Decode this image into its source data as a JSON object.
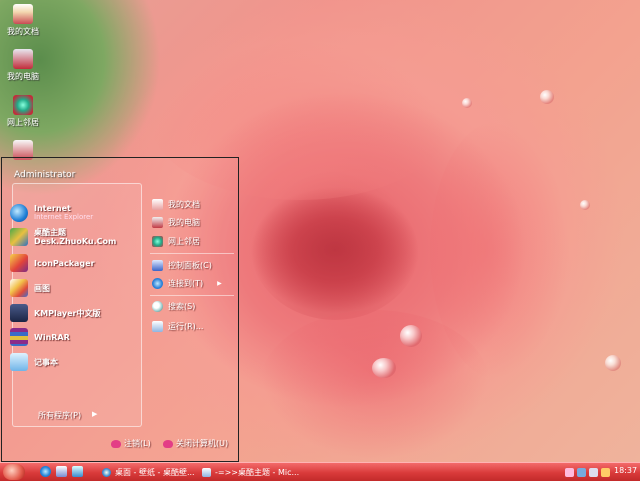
{
  "desktop": {
    "icons": [
      {
        "label": "我的文档"
      },
      {
        "label": "我的电脑"
      },
      {
        "label": "网上邻居"
      }
    ]
  },
  "start_menu": {
    "user_name": "Administrator",
    "pinned": [
      {
        "title": "Internet",
        "subtitle": "Internet Explorer"
      },
      {
        "title": "桌酷主题",
        "subtitle": "Desk.ZhuoKu.Com"
      },
      {
        "title": "IconPackager",
        "subtitle": ""
      },
      {
        "title": "画图",
        "subtitle": ""
      },
      {
        "title": "KMPlayer中文版",
        "subtitle": ""
      },
      {
        "title": "WinRAR",
        "subtitle": ""
      },
      {
        "title": "记事本",
        "subtitle": ""
      }
    ],
    "all_programs": "所有程序(P)",
    "places": [
      {
        "label": "我的文档"
      },
      {
        "label": "我的电脑"
      },
      {
        "label": "网上邻居"
      },
      {
        "label": "控制面板(C)"
      },
      {
        "label": "连接到(T)"
      },
      {
        "label": "搜索(S)"
      },
      {
        "label": "运行(R)..."
      }
    ],
    "logoff": "注销(L)",
    "shutdown": "关闭计算机(U)"
  },
  "taskbar": {
    "tasks": [
      {
        "label": "桌面 - 壁纸 - 桌酷壁..."
      },
      {
        "label": "-=>>桌酷主题 - Mic..."
      }
    ],
    "clock": "18:37"
  },
  "colors": {
    "taskbar": "#d93a3a",
    "wallpaper_rose": "#e8626a"
  }
}
